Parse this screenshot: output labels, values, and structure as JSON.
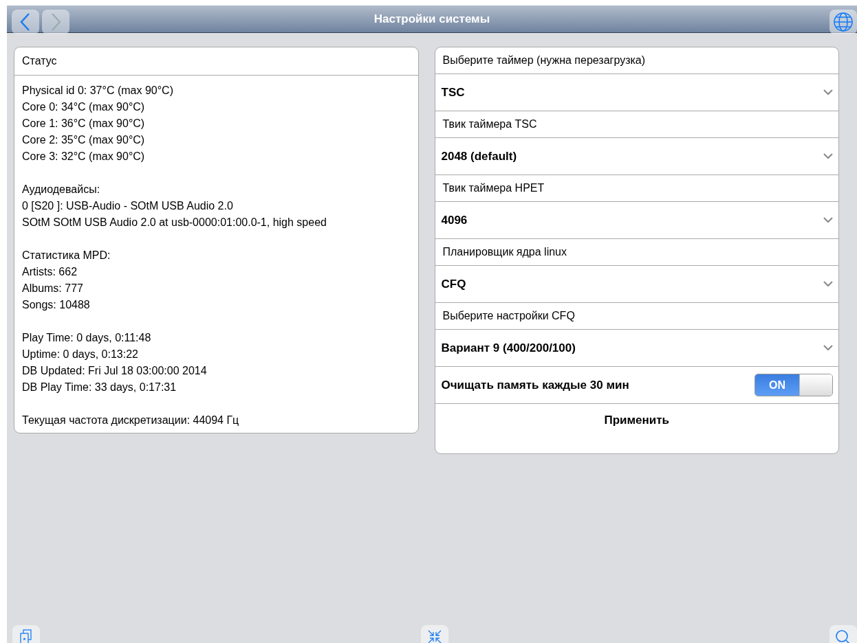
{
  "header": {
    "title": "Настройки системы"
  },
  "status": {
    "title": "Статус",
    "groups": [
      [
        "Physical id 0: 37°C (max 90°C)",
        "Core 0: 34°C (max 90°C)",
        "Core 1: 36°C (max 90°C)",
        "Core 2: 35°C (max 90°C)",
        "Core 3: 32°C (max 90°C)"
      ],
      [
        "Аудиодевайсы:",
        "0 [S20 ]: USB-Audio - SOtM USB Audio 2.0",
        "SOtM SOtM USB Audio 2.0 at usb-0000:01:00.0-1, high speed"
      ],
      [
        "Статистика MPD:",
        "Artists: 662",
        "Albums: 777",
        "Songs: 10488"
      ],
      [
        "Play Time: 0 days, 0:11:48",
        "Uptime: 0 days, 0:13:22",
        "DB Updated: Fri Jul 18 03:00:00 2014",
        "DB Play Time: 33 days, 0:17:31"
      ],
      [
        "Текущая частота дискретизации: 44094 Гц"
      ]
    ]
  },
  "settings": [
    {
      "kind": "label",
      "text": "Выберите таймер (нужна перезагрузка)"
    },
    {
      "kind": "select",
      "text": "TSC"
    },
    {
      "kind": "label",
      "text": "Твик таймера TSC"
    },
    {
      "kind": "select",
      "text": "2048 (default)"
    },
    {
      "kind": "label",
      "text": "Твик таймера HPET"
    },
    {
      "kind": "select",
      "text": "4096"
    },
    {
      "kind": "label",
      "text": "Планировщик ядра linux"
    },
    {
      "kind": "select",
      "text": "CFQ"
    },
    {
      "kind": "label",
      "text": "Выберите настройки CFQ"
    },
    {
      "kind": "select",
      "text": "Вариант 9 (400/200/100)"
    },
    {
      "kind": "toggle",
      "text": "Очищать память каждые 30 мин",
      "on": true,
      "state_label": "ON"
    },
    {
      "kind": "button",
      "text": "Применить"
    }
  ]
}
